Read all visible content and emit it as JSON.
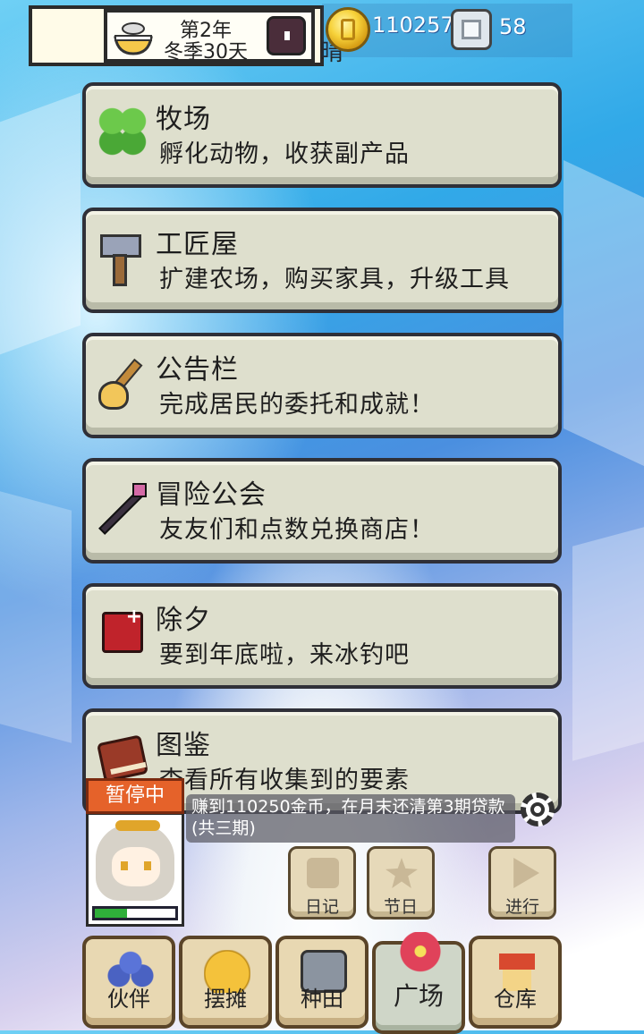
{
  "hud": {
    "year": "第2年",
    "season_day": "冬季30天",
    "weather": "晴",
    "gold": "110257",
    "gems": "58",
    "icons": [
      "food-bowl-icon",
      "clock-icon",
      "gold-coin-icon",
      "silver-gem-icon"
    ]
  },
  "menu": [
    {
      "title": "牧场",
      "desc": "孵化动物，收获副产品",
      "icon": "clover-icon"
    },
    {
      "title": "工匠屋",
      "desc": "扩建农场，购买家具，升级工具",
      "icon": "hammer-icon"
    },
    {
      "title": "公告栏",
      "desc": "完成居民的委托和成就！",
      "icon": "broom-icon"
    },
    {
      "title": "冒险公会",
      "desc": "友友们和点数兑换商店！",
      "icon": "staff-icon"
    },
    {
      "title": "除夕",
      "desc": "要到年底啦，来冰钓吧",
      "icon": "calendar-icon"
    },
    {
      "title": "图鉴",
      "desc": "查看所有收集到的要素",
      "icon": "book-icon"
    }
  ],
  "status": {
    "paused": "暂停中",
    "task": "赚到110250金币，在月末还清第3期贷款(共三期)",
    "energy_fraction": 0.4
  },
  "side_buttons": {
    "diary": "日记",
    "festival": "节日",
    "proceed": "进行"
  },
  "nav": [
    {
      "label": "伙伴",
      "icon": "people-icon"
    },
    {
      "label": "摆摊",
      "icon": "coins-icon"
    },
    {
      "label": "种田",
      "icon": "watering-can-icon"
    },
    {
      "label": "广场",
      "icon": "flower-icon"
    },
    {
      "label": "仓库",
      "icon": "house-icon"
    }
  ],
  "colors": {
    "card_bg": "#dedfcd",
    "paused_bg": "#e5622a",
    "energy": "#2fae3a"
  }
}
